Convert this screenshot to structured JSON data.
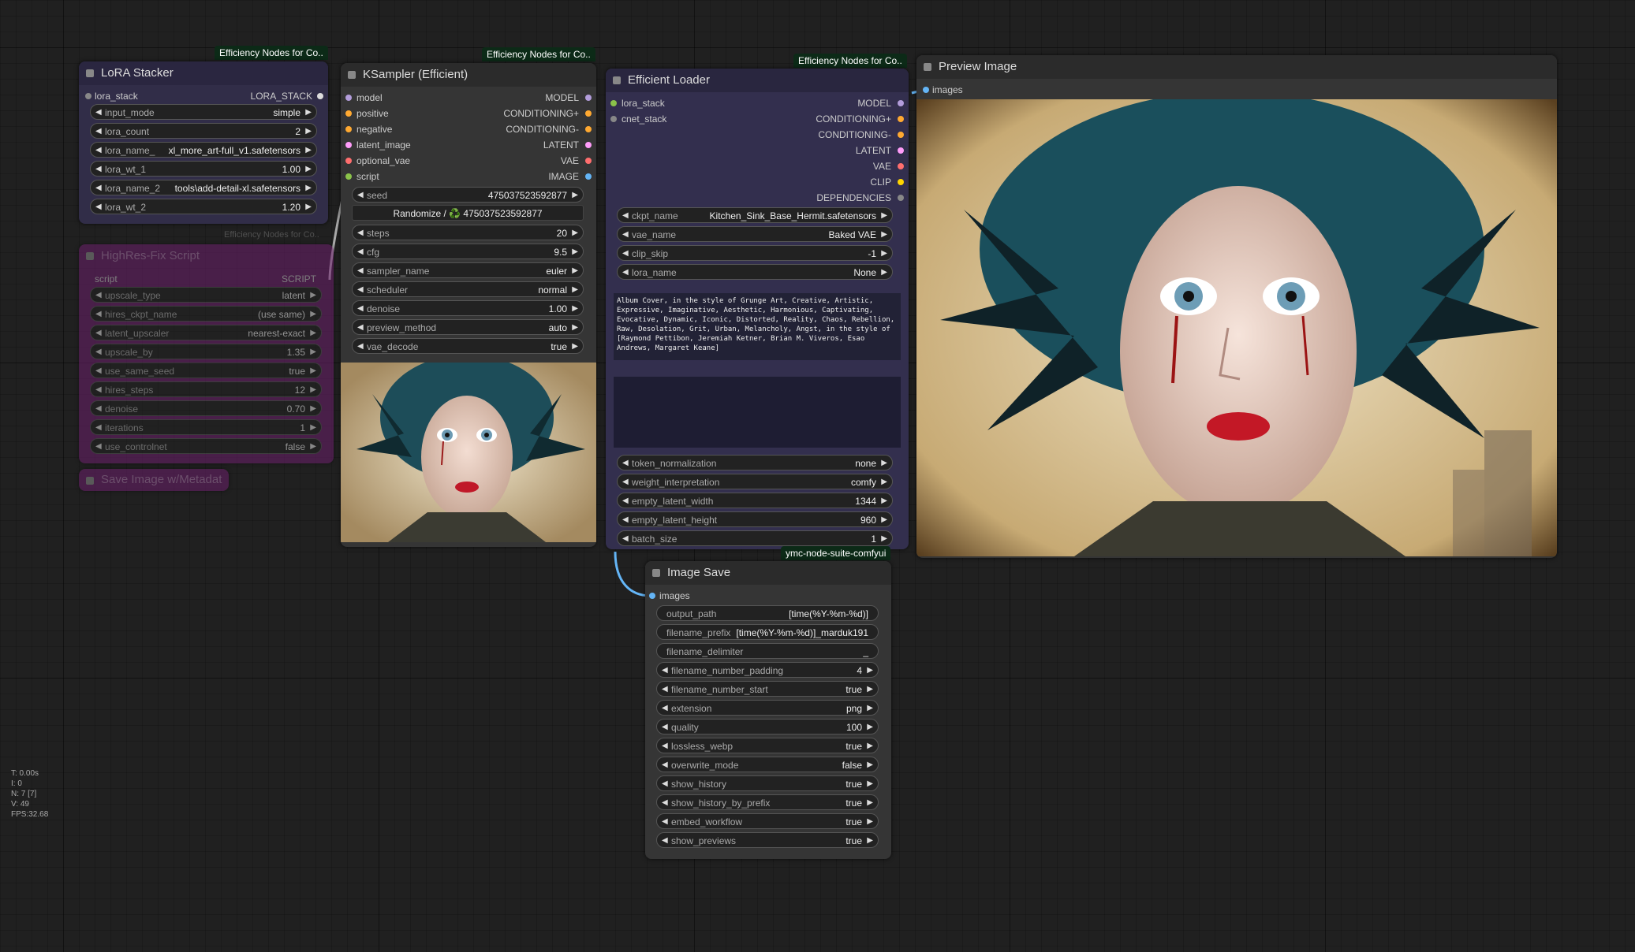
{
  "badges": {
    "lora": "Efficiency Nodes for Co..",
    "ksampler": "Efficiency Nodes for Co..",
    "loader": "Efficiency Nodes for Co..",
    "highres": "Efficiency Nodes for Co..",
    "save": "ymc-node-suite-comfyui"
  },
  "lora": {
    "title": "LoRA Stacker",
    "input": "lora_stack",
    "output": "LORA_STACK",
    "w": [
      {
        "label": "input_mode",
        "value": "simple"
      },
      {
        "label": "lora_count",
        "value": "2"
      },
      {
        "label": "lora_name_",
        "value": "xl_more_art-full_v1.safetensors"
      },
      {
        "label": "lora_wt_1",
        "value": "1.00"
      },
      {
        "label": "lora_name_2",
        "value": "tools\\add-detail-xl.safetensors"
      },
      {
        "label": "lora_wt_2",
        "value": "1.20"
      }
    ]
  },
  "highres": {
    "title": "HighRes-Fix Script",
    "input": "script",
    "output": "SCRIPT",
    "w": [
      {
        "label": "upscale_type",
        "value": "latent"
      },
      {
        "label": "hires_ckpt_name",
        "value": "(use same)"
      },
      {
        "label": "latent_upscaler",
        "value": "nearest-exact"
      },
      {
        "label": "upscale_by",
        "value": "1.35"
      },
      {
        "label": "use_same_seed",
        "value": "true"
      },
      {
        "label": "hires_steps",
        "value": "12"
      },
      {
        "label": "denoise",
        "value": "0.70"
      },
      {
        "label": "iterations",
        "value": "1"
      },
      {
        "label": "use_controlnet",
        "value": "false"
      }
    ]
  },
  "savemeta": {
    "title": "Save Image w/Metadat"
  },
  "ksampler": {
    "title": "KSampler (Efficient)",
    "inputs": [
      "model",
      "positive",
      "negative",
      "latent_image",
      "optional_vae",
      "script"
    ],
    "outputs": [
      "MODEL",
      "CONDITIONING+",
      "CONDITIONING-",
      "LATENT",
      "VAE",
      "IMAGE"
    ],
    "seed": {
      "label": "seed",
      "value": "475037523592877"
    },
    "randomize": "Randomize / ♻️ 475037523592877",
    "w": [
      {
        "label": "steps",
        "value": "20"
      },
      {
        "label": "cfg",
        "value": "9.5"
      },
      {
        "label": "sampler_name",
        "value": "euler"
      },
      {
        "label": "scheduler",
        "value": "normal"
      },
      {
        "label": "denoise",
        "value": "1.00"
      },
      {
        "label": "preview_method",
        "value": "auto"
      },
      {
        "label": "vae_decode",
        "value": "true"
      }
    ]
  },
  "loader": {
    "title": "Efficient Loader",
    "inputs": [
      "lora_stack",
      "cnet_stack"
    ],
    "outputs": [
      "MODEL",
      "CONDITIONING+",
      "CONDITIONING-",
      "LATENT",
      "VAE",
      "CLIP",
      "DEPENDENCIES"
    ],
    "w1": [
      {
        "label": "ckpt_name",
        "value": "Kitchen_Sink_Base_Hermit.safetensors"
      },
      {
        "label": "vae_name",
        "value": "Baked VAE"
      },
      {
        "label": "clip_skip",
        "value": "-1"
      },
      {
        "label": "lora_name",
        "value": "None"
      }
    ],
    "prompt": "Album Cover, in the style of Grunge Art, Creative, Artistic, Expressive, Imaginative, Aesthetic, Harmonious, Captivating, Evocative, Dynamic, Iconic, Distorted, Reality, Chaos, Rebellion, Raw, Desolation, Grit, Urban, Melancholy, Angst, in the style of [Raymond Pettibon, Jeremiah Ketner, Brian M. Viveros, Esao Andrews, Margaret Keane]",
    "negative": "",
    "w2": [
      {
        "label": "token_normalization",
        "value": "none"
      },
      {
        "label": "weight_interpretation",
        "value": "comfy"
      },
      {
        "label": "empty_latent_width",
        "value": "1344"
      },
      {
        "label": "empty_latent_height",
        "value": "960"
      },
      {
        "label": "batch_size",
        "value": "1"
      }
    ]
  },
  "preview": {
    "title": "Preview Image",
    "input": "images"
  },
  "imagesave": {
    "title": "Image Save",
    "input": "images",
    "text": [
      {
        "label": "output_path",
        "value": "[time(%Y-%m-%d)]"
      },
      {
        "label": "filename_prefix",
        "value": "[time(%Y-%m-%d)]_marduk191"
      },
      {
        "label": "filename_delimiter",
        "value": "_"
      }
    ],
    "w": [
      {
        "label": "filename_number_padding",
        "value": "4"
      },
      {
        "label": "filename_number_start",
        "value": "true"
      },
      {
        "label": "extension",
        "value": "png"
      },
      {
        "label": "quality",
        "value": "100"
      },
      {
        "label": "lossless_webp",
        "value": "true"
      },
      {
        "label": "overwrite_mode",
        "value": "false"
      },
      {
        "label": "show_history",
        "value": "true"
      },
      {
        "label": "show_history_by_prefix",
        "value": "true"
      },
      {
        "label": "embed_workflow",
        "value": "true"
      },
      {
        "label": "show_previews",
        "value": "true"
      }
    ]
  },
  "stats": [
    "T: 0.00s",
    "I: 0",
    "N: 7 [7]",
    "V: 49",
    "FPS:32.68"
  ],
  "colors": {
    "model": "#b39ddb",
    "conditioning": "#ffa931",
    "latent": "#ff9cf9",
    "vae": "#ff6e6e",
    "image": "#64b5f6",
    "clip": "#ffd500"
  }
}
